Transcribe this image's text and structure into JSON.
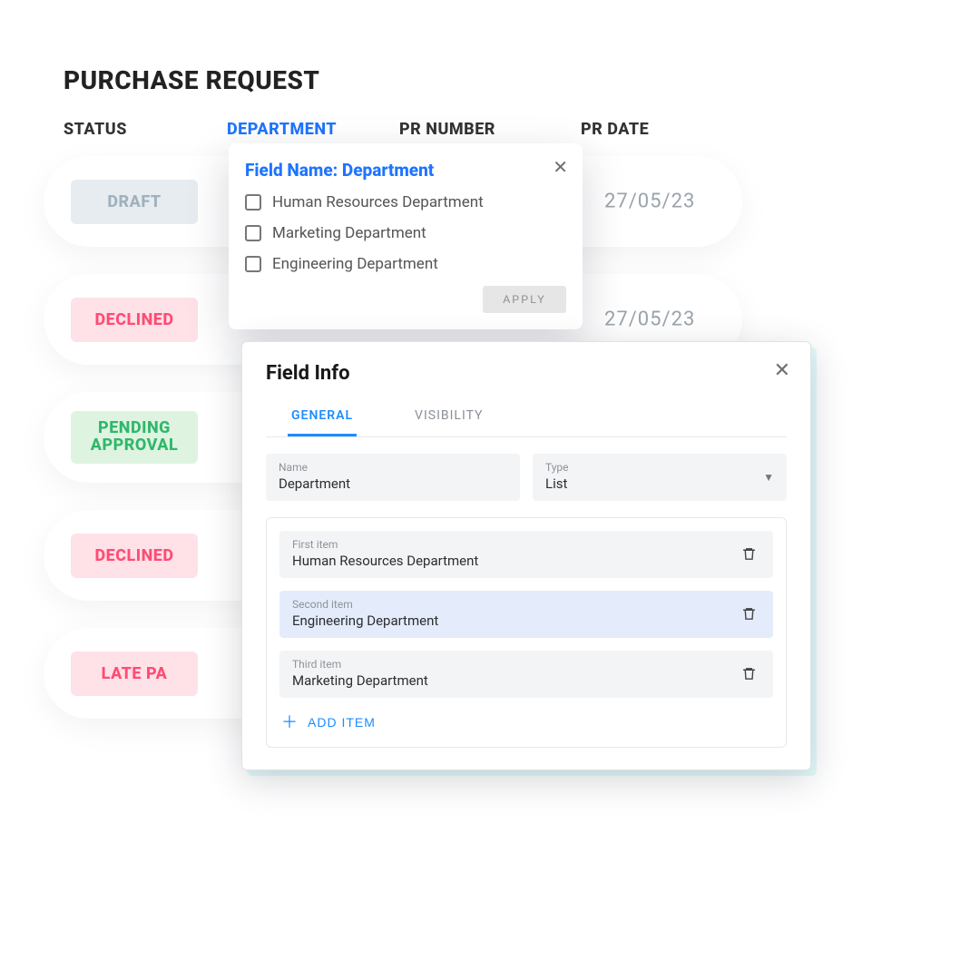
{
  "page": {
    "title": "PURCHASE REQUEST"
  },
  "headers": {
    "status": "STATUS",
    "department": "DEPARTMENT",
    "prnum": "PR NUMBER",
    "prdate": "PR DATE"
  },
  "rows": [
    {
      "status": "DRAFT",
      "style": "draft",
      "date": "27/05/23"
    },
    {
      "status": "DECLINED",
      "style": "declined",
      "date": "27/05/23"
    },
    {
      "status": "PENDING\nAPPROVAL",
      "style": "pending",
      "date": ""
    },
    {
      "status": "DECLINED",
      "style": "declined",
      "date": ""
    },
    {
      "status": "LATE PA",
      "style": "late",
      "date": ""
    }
  ],
  "popover": {
    "title": "Field Name: Department",
    "options": [
      "Human Resources Department",
      "Marketing Department",
      "Engineering Department"
    ],
    "apply": "APPLY"
  },
  "modal": {
    "title": "Field Info",
    "tabs": {
      "general": "GENERAL",
      "visibility": "VISIBILITY"
    },
    "name_label": "Name",
    "name_value": "Department",
    "type_label": "Type",
    "type_value": "List",
    "items": [
      {
        "label": "First item",
        "value": "Human Resources Department",
        "selected": false
      },
      {
        "label": "Second item",
        "value": "Engineering Department",
        "selected": true
      },
      {
        "label": "Third item",
        "value": "Marketing Department",
        "selected": false
      }
    ],
    "add_item": "ADD ITEM"
  }
}
